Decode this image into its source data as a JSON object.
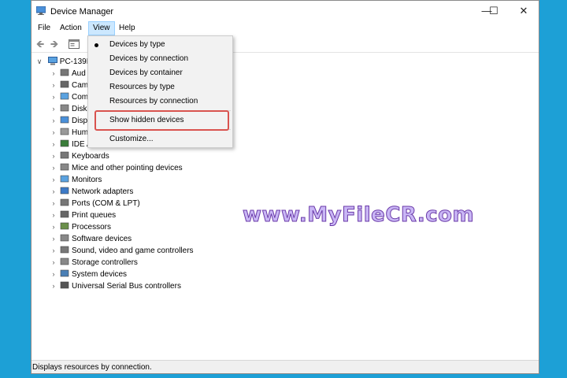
{
  "window": {
    "title": "Device Manager",
    "controls": {
      "minimize": "—",
      "maximize": "☐",
      "close": "✕"
    }
  },
  "menubar": [
    {
      "label": "File"
    },
    {
      "label": "Action"
    },
    {
      "label": "View"
    },
    {
      "label": "Help"
    }
  ],
  "toolbar": {
    "back": "🡸",
    "forward": "🡺"
  },
  "tree": {
    "root": "PC-139F",
    "items": [
      {
        "label": "Aud",
        "icon": "audio-icon"
      },
      {
        "label": "Cam",
        "icon": "camera-icon"
      },
      {
        "label": "Com",
        "icon": "computer-icon"
      },
      {
        "label": "Disk",
        "icon": "disk-icon"
      },
      {
        "label": "Disp",
        "icon": "display-icon"
      },
      {
        "label": "Hum",
        "icon": "hid-icon"
      },
      {
        "label": "IDE A",
        "icon": "ide-icon"
      },
      {
        "label": "Keyboards",
        "icon": "keyboard-icon"
      },
      {
        "label": "Mice and other pointing devices",
        "icon": "mouse-icon"
      },
      {
        "label": "Monitors",
        "icon": "monitor-icon"
      },
      {
        "label": "Network adapters",
        "icon": "network-icon"
      },
      {
        "label": "Ports (COM & LPT)",
        "icon": "port-icon"
      },
      {
        "label": "Print queues",
        "icon": "printer-icon"
      },
      {
        "label": "Processors",
        "icon": "processor-icon"
      },
      {
        "label": "Software devices",
        "icon": "software-icon"
      },
      {
        "label": "Sound, video and game controllers",
        "icon": "sound-icon"
      },
      {
        "label": "Storage controllers",
        "icon": "storage-icon"
      },
      {
        "label": "System devices",
        "icon": "system-icon"
      },
      {
        "label": "Universal Serial Bus controllers",
        "icon": "usb-icon"
      }
    ]
  },
  "view_menu": {
    "items": [
      {
        "label": "Devices by type",
        "checked": true
      },
      {
        "label": "Devices by connection"
      },
      {
        "label": "Devices by container"
      },
      {
        "label": "Resources by type"
      },
      {
        "label": "Resources by connection"
      },
      {
        "label": "Show hidden devices"
      },
      {
        "label": "Customize..."
      }
    ]
  },
  "statusbar": {
    "text": "Displays resources by connection."
  },
  "watermark": {
    "text": "www.MyFileCR.com"
  },
  "colors": {
    "desktop": "#1da0d6",
    "menu_active": "#cce8ff",
    "highlight_box": "#d9534f"
  }
}
